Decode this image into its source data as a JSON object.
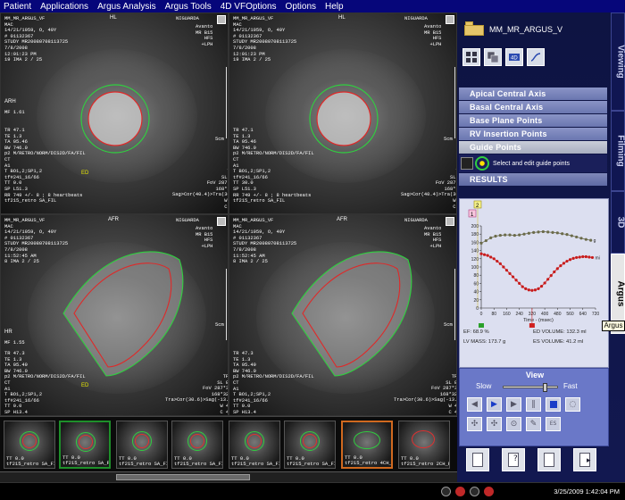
{
  "menu": [
    "Patient",
    "Applications",
    "Argus Analysis",
    "Argus Tools",
    "4D VFOptions",
    "Options",
    "Help"
  ],
  "viewports": [
    {
      "orient_top": "HL",
      "orient_left": "ARH",
      "corner_right": "NIGUARDA",
      "info_tl": "MM_MR_ARGUS_VF\nMAC\n14/21/1959, O, 49Y\n# 01132367\nSTUDY MR20080708113725\n7/8/2008\n12:01:23 PM\n19 IMA 2 / 25",
      "info_tr": "Avanto\nMR B15\nHFS\n+LPH",
      "info_ml": "MF 1.61",
      "info_bl": "TR 47.1\nTE 1.3\nTA 05.46\nBW 746.0\np2 M/RETRO/NORM/DIS2D/FA/FIL\nCT\nA1\nT BO1,2;SP1,2\ntf#241_16/66\nTT 0.0\nSP L51.3\nRR 749 +/- 8 ; 8 heartbeats\ntf215_retro SA_FIL",
      "info_br": "TP 0\nSL 8.0\nFoV 287*360\n168*320s\nSag>Cor(40.4)>Tra(30.4)\nW 859\nC 375",
      "marker": "ED",
      "scale": "5cm"
    },
    {
      "orient_top": "HL",
      "orient_left": "",
      "corner_right": "NIGUARDA",
      "info_tl": "MM_MR_ARGUS_VF\nMAC\n14/21/1959, O, 49Y\n# 01132367\nSTUDY MR20080708113725\n7/8/2008\n12:01:23 PM\n19 IMA 2 / 25",
      "info_tr": "Avanto\nMR B15\nHFS\n+LPH",
      "info_ml": "",
      "info_bl": "TR 47.1\nTE 1.3\nTA 05.46\nBW 746.0\np2 M/RETRO/NORM/DIS2D/FA/FIL\nCT\nA1\nT BO1,2;SP1,2\ntf#241_16/66\nTT 30.0\nSP L51.3\nRR 749 +/- 8 ; 8 heartbeats\ntf215_retro SA_FIL",
      "info_br": "TP 0\nSL 8.0\nFoV 287*360\n168*320s\nSag>Cor(40.4)>Tra(30.4)\nW 857\nC 375",
      "marker": "",
      "scale": "5cm"
    },
    {
      "orient_top": "AFR",
      "orient_left": "HR",
      "corner_right": "NIGUARDA",
      "info_tl": "MM_MR_ARGUS_VF\nMAC\n14/21/1959, O, 49Y\n# 01132367\nSTUDY MR20080708113725\n7/8/2008\n11:52:45 AM\n8 IMA 2 / 25",
      "info_tr": "Avanto\nMR B15\nHFS\n+LPH",
      "info_ml": "MF 1.55",
      "info_bl": "TR 47.3\nTE 1.3\nTA 05.49\nBW 746.0\np2 M/RETRO/NORM/DIS2D/FA/FIL\nCT\nA1\nT BO1,2;SP1,2\ntf#241_16/66\nTT 0.0\nSP H13.4\nRR 749 +/- 8 ; 8 heartbeats\ntf215_retro 4CH_FIL",
      "info_br": "TP 0\nSL 8.0\nFoV 287*360\n168*320s\nTra>Cor(30.6)>Sag(-13.8)\nW 409\nC 406",
      "marker": "ED",
      "scale": "5cm"
    },
    {
      "orient_top": "AFR",
      "orient_left": "",
      "corner_right": "NIGUARDA",
      "info_tl": "MM_MR_ARGUS_VF\nMAC\n14/21/1959, O, 49Y\n# 01132367\nSTUDY MR20080708113725\n7/8/2008\n11:52:45 AM\n8 IMA 2 / 25",
      "info_tr": "Avanto\nMR B15\nHFS\n+LPH",
      "info_ml": "",
      "info_bl": "TR 47.3\nTE 1.3\nTA 05.49\nBW 746.0\np2 M/RETRO/NORM/DIS2D/FA/FIL\nCT\nA1\nT BO1,2;SP1,2\ntf#241_16/66\nTT 0.0\nSP H13.4\nRR 749 +/- 8 ; 8 heartbeats\ntf215_retro 4CH_FIL",
      "info_br": "TP 0\nSL 8.0\nFoV 287*360\n168*320s\nTra>Cor(30.6)>Sag(-13.8)\nW 407\nC 406",
      "marker": "",
      "scale": "5cm"
    }
  ],
  "thumbnails": [
    {
      "label": "TT 0.0\ntf215_retro SA_FIL",
      "kind": "sa",
      "selected": ""
    },
    {
      "label": "TT 0.0\ntf215_retro SA_FIL",
      "kind": "sa",
      "selected": "green"
    },
    {
      "label": "TT 0.0\ntf215_retro SA_FIL",
      "kind": "sa",
      "selected": ""
    },
    {
      "label": "TT 0.0\ntf215_retro SA_FIL",
      "kind": "sa",
      "selected": ""
    },
    {
      "label": "TT 0.0\ntf215_retro SA_FIL",
      "kind": "sa",
      "selected": ""
    },
    {
      "label": "TT 0.0\ntf215_retro SA_FIL",
      "kind": "sa",
      "selected": ""
    },
    {
      "label": "TT 0.0\ntf215_retro 4CH_FIL",
      "kind": "la",
      "selected": "orange"
    },
    {
      "label": "TT 0.0\ntf215_retro 2CH_FIL",
      "kind": "la",
      "selected": ""
    }
  ],
  "series_name": "MM_MR_ARGUS_V",
  "tool_icons": [
    "layout-grid-icon",
    "copy-images-icon",
    "4d-view-icon",
    "curve-tool-icon"
  ],
  "steps": [
    {
      "label": "Apical Central Axis",
      "state": "normal"
    },
    {
      "label": "Basal Central Axis",
      "state": "normal"
    },
    {
      "label": "Base Plane Points",
      "state": "normal"
    },
    {
      "label": "RV Insertion Points",
      "state": "normal"
    },
    {
      "label": "Guide Points",
      "state": "active"
    }
  ],
  "guide_hint": "Select and edit guide points",
  "results_label": "RESULTS",
  "side_tabs": [
    "Viewing",
    "Filming",
    "3D",
    "Argus"
  ],
  "tooltip": "Argus",
  "chart_data": {
    "type": "line",
    "xlabel": "Time - (msec)",
    "ylabel": "",
    "xlim": [
      0,
      720
    ],
    "ylim": [
      0,
      200
    ],
    "xticks": [
      0,
      80,
      160,
      240,
      320,
      400,
      480,
      560,
      640,
      720
    ],
    "yticks": [
      0,
      20,
      40,
      60,
      80,
      100,
      120,
      140,
      160,
      180,
      200
    ],
    "markers_top": [
      "1",
      "2"
    ],
    "series": [
      {
        "name": "",
        "end_label": "g",
        "color": "#6b6b4a",
        "x": [
          0,
          30,
          60,
          90,
          120,
          150,
          180,
          210,
          240,
          270,
          300,
          330,
          360,
          390,
          420,
          450,
          480,
          510,
          540,
          570,
          600,
          630,
          660,
          690
        ],
        "values": [
          158,
          164,
          171,
          175,
          177,
          178,
          178,
          177,
          178,
          180,
          182,
          184,
          185,
          186,
          185,
          184,
          183,
          181,
          179,
          176,
          173,
          170,
          167,
          165
        ]
      },
      {
        "name": "",
        "end_label": "mi",
        "color": "#c81c1c",
        "x": [
          0,
          20,
          40,
          60,
          80,
          100,
          120,
          140,
          160,
          180,
          200,
          220,
          240,
          260,
          280,
          300,
          320,
          340,
          360,
          380,
          400,
          420,
          440,
          460,
          480,
          500,
          520,
          540,
          560,
          580,
          600,
          620,
          640,
          660,
          680,
          700
        ],
        "values": [
          132,
          130,
          128,
          124,
          120,
          114,
          108,
          100,
          92,
          84,
          76,
          68,
          60,
          52,
          47,
          44,
          43,
          44,
          47,
          53,
          61,
          70,
          79,
          88,
          96,
          103,
          109,
          114,
          118,
          121,
          123,
          124,
          125,
          125,
          124,
          123
        ]
      }
    ]
  },
  "metrics": {
    "ef": "EF: 68.9 %",
    "ed_volume": "ED VOLUME: 132.3 ml",
    "lv_mass": "LV MASS: 173.7 g",
    "es_volume": "ES VOLUME: 41.2 ml"
  },
  "view_panel": {
    "title": "View",
    "slow": "Slow",
    "fast": "Fast",
    "speed_level": 0.78
  },
  "clock": "3/25/2009 1:42:04 PM"
}
